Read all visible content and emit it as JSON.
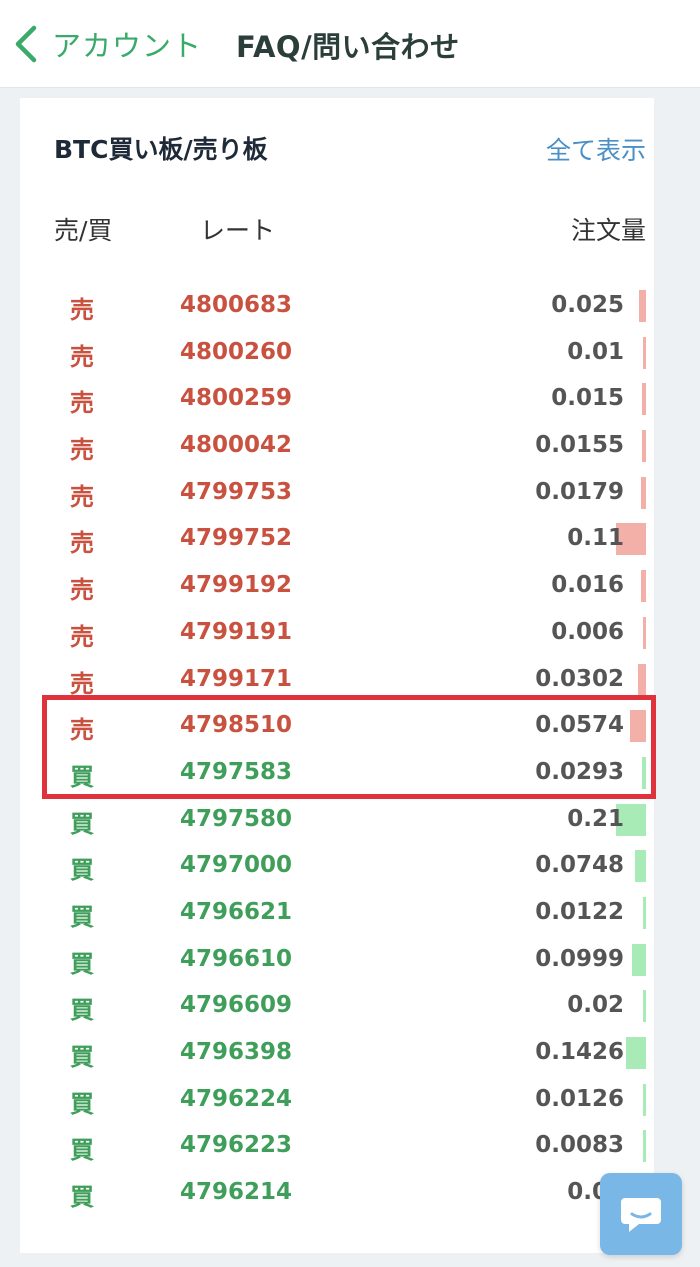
{
  "nav": {
    "back_label": "アカウント",
    "title": "FAQ/問い合わせ"
  },
  "card": {
    "title": "BTC買い板/売り板",
    "show_all": "全て表示",
    "columns": {
      "side": "売/買",
      "rate": "レート",
      "qty": "注文量"
    }
  },
  "orders": [
    {
      "side": "売",
      "type": "sell",
      "rate": "4800683",
      "qty": "0.025",
      "bar": 0.23
    },
    {
      "side": "売",
      "type": "sell",
      "rate": "4800260",
      "qty": "0.01",
      "bar": 0.09
    },
    {
      "side": "売",
      "type": "sell",
      "rate": "4800259",
      "qty": "0.015",
      "bar": 0.13
    },
    {
      "side": "売",
      "type": "sell",
      "rate": "4800042",
      "qty": "0.0155",
      "bar": 0.14
    },
    {
      "side": "売",
      "type": "sell",
      "rate": "4799753",
      "qty": "0.0179",
      "bar": 0.16
    },
    {
      "side": "売",
      "type": "sell",
      "rate": "4799752",
      "qty": "0.11",
      "bar": 1.0
    },
    {
      "side": "売",
      "type": "sell",
      "rate": "4799192",
      "qty": "0.016",
      "bar": 0.15
    },
    {
      "side": "売",
      "type": "sell",
      "rate": "4799191",
      "qty": "0.006",
      "bar": 0.06
    },
    {
      "side": "売",
      "type": "sell",
      "rate": "4799171",
      "qty": "0.0302",
      "bar": 0.28
    },
    {
      "side": "売",
      "type": "sell",
      "rate": "4798510",
      "qty": "0.0574",
      "bar": 0.52
    },
    {
      "side": "買",
      "type": "buy",
      "rate": "4797583",
      "qty": "0.0293",
      "bar": 0.14
    },
    {
      "side": "買",
      "type": "buy",
      "rate": "4797580",
      "qty": "0.21",
      "bar": 1.0
    },
    {
      "side": "買",
      "type": "buy",
      "rate": "4797000",
      "qty": "0.0748",
      "bar": 0.36
    },
    {
      "side": "買",
      "type": "buy",
      "rate": "4796621",
      "qty": "0.0122",
      "bar": 0.06
    },
    {
      "side": "買",
      "type": "buy",
      "rate": "4796610",
      "qty": "0.0999",
      "bar": 0.48
    },
    {
      "side": "買",
      "type": "buy",
      "rate": "4796609",
      "qty": "0.02",
      "bar": 0.1
    },
    {
      "side": "買",
      "type": "buy",
      "rate": "4796398",
      "qty": "0.1426",
      "bar": 0.68
    },
    {
      "side": "買",
      "type": "buy",
      "rate": "4796224",
      "qty": "0.0126",
      "bar": 0.06
    },
    {
      "side": "買",
      "type": "buy",
      "rate": "4796223",
      "qty": "0.0083",
      "bar": 0.04
    },
    {
      "side": "買",
      "type": "buy",
      "rate": "4796214",
      "qty": "0.00",
      "bar": 0.05
    }
  ],
  "colors": {
    "sell": "#c9513f",
    "buy": "#3e9e5a",
    "sell_bar": "#f2b0a8",
    "buy_bar": "#a9ebb7",
    "highlight": "#e0323c",
    "accent": "#3aaa6b"
  },
  "icons": {
    "back": "chevron-left-icon",
    "chat": "chat-bubble-icon"
  }
}
